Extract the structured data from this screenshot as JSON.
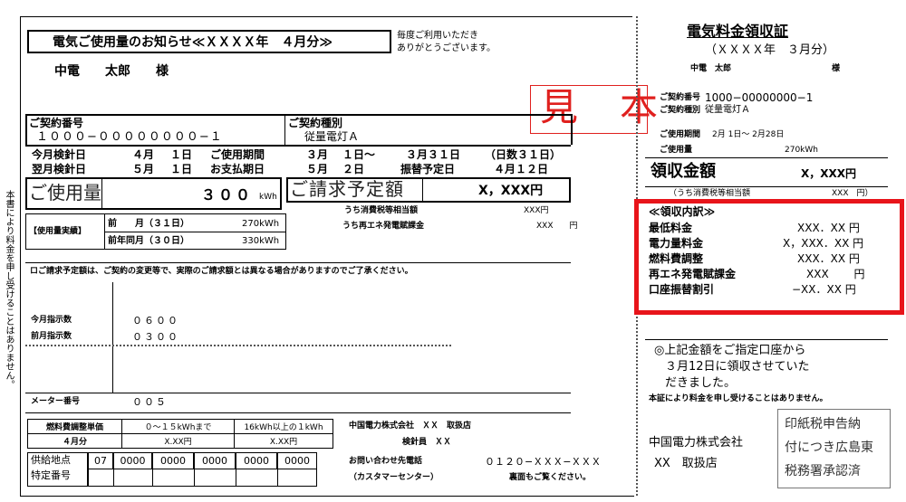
{
  "notice": {
    "title": "電気ご使用量のお知らせ≪ＸＸＸＸ年　４月分≫",
    "greeting_1": "毎度ご利用いただき",
    "greeting_2": "ありがとうございます。",
    "customer": "中電　　太郎　　様",
    "stamp": "見　本",
    "contract_no_label": "ご契約番号",
    "contract_no": "１０００−００００００００−１",
    "contract_type_label": "ご契約種別",
    "contract_type": "従量電灯Ａ",
    "meter_rows": [
      {
        "a": "今月検針日",
        "b": "４月",
        "c": "１日",
        "d": "ご使用期間",
        "e": "３月",
        "f": "１日〜",
        "g": "３月３１日",
        "h": "（日数３１日）"
      },
      {
        "a": "翌月検針日",
        "b": "５月",
        "c": "１日",
        "d": "お支払期日",
        "e": "５月",
        "f": "２日",
        "g": "振替予定日",
        "h": "４月１２日"
      }
    ],
    "usage_label": "ご使用量",
    "usage_value": "３００",
    "usage_unit": "kWh",
    "billing_label": "ご請求予定額",
    "billing_value": "X，XXX円",
    "tax_label": "うち消費税等相当額",
    "tax_value": "XXX円",
    "history_label": "【使用量実績】",
    "history_rows": [
      {
        "label": "前　　月（３１日）",
        "value": "270kWh"
      },
      {
        "label": "前年同月（３０日）",
        "value": "330kWh"
      }
    ],
    "surcharge_label": "うち再エネ発電賦課金",
    "surcharge_value": "XXX　　円",
    "note": "ロご請求予定額は、ご契約の変更等で、実際のご請求額とは異なる場合がありますのでご了承ください。",
    "reading_this_label": "今月指示数",
    "reading_this": "０６００",
    "reading_prev_label": "前月指示数",
    "reading_prev": "０３００",
    "meter_no_label": "メーター番号",
    "meter_no": "００５",
    "side_note": "本書により料金を申し受けることはありません。",
    "fuel_headers": [
      "燃料費調整単価",
      "０〜１５kWhまで",
      "16kWh以上の１kWh"
    ],
    "fuel_values": [
      "４月分",
      "X.XX円",
      "X.XX円"
    ],
    "supply_label_1": "供給地点",
    "supply_label_2": "特定番号",
    "supply_cells": [
      "07",
      "0000",
      "0000",
      "0000",
      "0000",
      "0000"
    ],
    "company_line": "中国電力株式会社　ＸＸ　取扱店",
    "inspector": "検針員　ＸＸ",
    "inquiry_label": "お問い合わせ先電話",
    "inquiry_phone": "０１２０−ＸＸＸ−ＸＸＸ",
    "center": "（カスタマーセンター）",
    "reverse": "裏面もご覧ください。"
  },
  "receipt": {
    "title": "電気料金領収証",
    "period": "（ＸＸＸＸ年　３月分）",
    "customer": "中電　太郎",
    "sama": "様",
    "contract_no_label": "ご契約番号",
    "contract_no": "1000−00000000−1",
    "contract_type_label": "ご契約種別",
    "contract_type": "従量電灯Ａ",
    "period_label": "ご使用期間",
    "period_value": "2月 1日〜 2月28日",
    "usage_label": "ご使用量",
    "usage_value": "270kWh",
    "amount_label": "領収金額",
    "amount_value": "X，XXX円",
    "tax_label": "（うち消費税等相当額",
    "tax_value": "XXX　円）",
    "breakdown_title": "≪領収内訳≫",
    "breakdown": [
      {
        "label": "最低料金",
        "value": "XXX．XX 円"
      },
      {
        "label": "電力量料金",
        "value": "X，XXX．XX 円"
      },
      {
        "label": "燃料費調整",
        "value": "XXX．XX 円"
      },
      {
        "label": "再エネ発電賦課金",
        "value": "XXX　　 円"
      },
      {
        "label": "口座振替割引",
        "value": "−XX．XX 円"
      }
    ],
    "message_1": "◎上記金額をご指定口座から",
    "message_2": "３月12日に領収させていた",
    "message_3": "だきました。",
    "disclaimer": "本証により料金を申し受けることはありません。",
    "company": "中国電力株式会社",
    "branch": "XX　取扱店",
    "tax_stamp_1": "印紙税申告納",
    "tax_stamp_2": "付につき広島東",
    "tax_stamp_3": "税務署承認済"
  },
  "colors": {
    "stamp": "#e0201e",
    "highlight": "#e8141a",
    "line": "#000000"
  }
}
